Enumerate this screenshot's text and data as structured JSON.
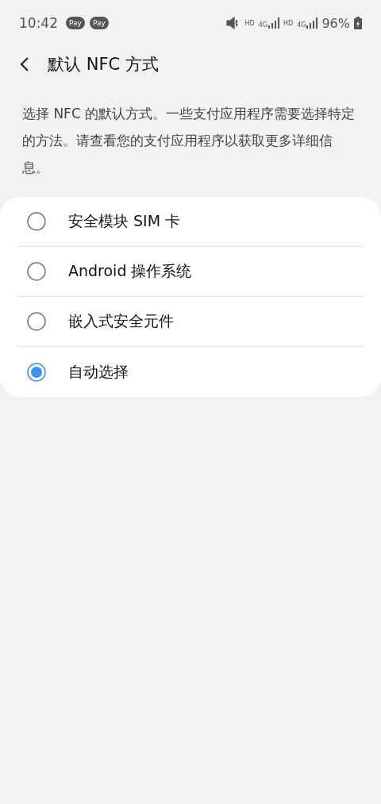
{
  "status_bar": {
    "time": "10:42",
    "notifications": [
      "Pay",
      "Pay"
    ],
    "sims": [
      {
        "hd": "HD",
        "network": "4G"
      },
      {
        "hd": "HD",
        "network": "4G"
      }
    ],
    "battery": "96%"
  },
  "header": {
    "title": "默认 NFC 方式"
  },
  "description": "选择 NFC 的默认方式。一些支付应用程序需要选择特定的方法。请查看您的支付应用程序以获取更多详细信息。",
  "options": [
    {
      "label": "安全模块 SIM 卡",
      "selected": false
    },
    {
      "label": "Android 操作系统",
      "selected": false
    },
    {
      "label": "嵌入式安全元件",
      "selected": false
    },
    {
      "label": "自动选择",
      "selected": true
    }
  ]
}
